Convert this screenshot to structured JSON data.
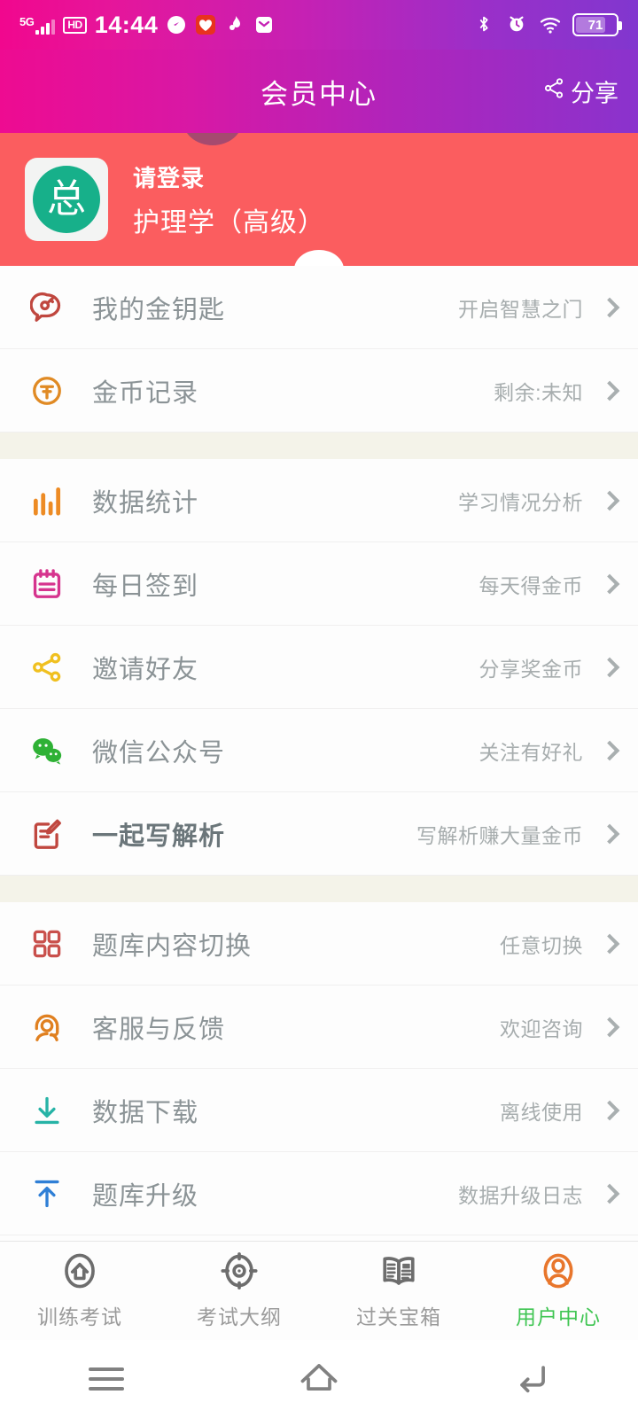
{
  "status_bar": {
    "network": "5G",
    "hd": "HD",
    "time": "14:44",
    "battery_level": "71",
    "left_icons": [
      "signal-icon",
      "hd-icon",
      "compass-icon",
      "heart-badge-icon",
      "flame-icon",
      "mail-icon"
    ],
    "right_icons": [
      "bluetooth-icon",
      "alarm-icon",
      "wifi-icon",
      "battery-icon"
    ]
  },
  "header": {
    "title": "会员中心",
    "share_label": "分享",
    "share_icon": "share-icon"
  },
  "profile": {
    "avatar_text": "总",
    "login_label": "请登录",
    "subject": "护理学（高级）"
  },
  "menu_groups": [
    {
      "items": [
        {
          "icon": "key-bubble-icon",
          "label": "我的金钥匙",
          "hint": "开启智慧之门",
          "color": "#c0473f",
          "strong": false
        },
        {
          "icon": "coin-icon",
          "label": "金币记录",
          "hint": "剩余:未知",
          "color": "#e08a24",
          "strong": false
        }
      ]
    },
    {
      "items": [
        {
          "icon": "bar-chart-icon",
          "label": "数据统计",
          "hint": "学习情况分析",
          "color": "#ed8b24",
          "strong": false
        },
        {
          "icon": "calendar-icon",
          "label": "每日签到",
          "hint": "每天得金币",
          "color": "#d6348e",
          "strong": false
        },
        {
          "icon": "share-nodes-icon",
          "label": "邀请好友",
          "hint": "分享奖金币",
          "color": "#f0c020",
          "strong": false
        },
        {
          "icon": "wechat-icon",
          "label": "微信公众号",
          "hint": "关注有好礼",
          "color": "#2eb135",
          "strong": false
        },
        {
          "icon": "edit-note-icon",
          "label": "一起写解析",
          "hint": "写解析赚大量金币",
          "color": "#c0473f",
          "strong": true
        }
      ]
    },
    {
      "items": [
        {
          "icon": "grid-icon",
          "label": "题库内容切换",
          "hint": "任意切换",
          "color": "#c9504c",
          "strong": false
        },
        {
          "icon": "headset-support-icon",
          "label": "客服与反馈",
          "hint": "欢迎咨询",
          "color": "#e08020",
          "strong": false
        },
        {
          "icon": "download-icon",
          "label": "数据下载",
          "hint": "离线使用",
          "color": "#26b3a6",
          "strong": false
        },
        {
          "icon": "upload-icon",
          "label": "题库升级",
          "hint": "数据升级日志",
          "color": "#2f7fd6",
          "strong": false
        }
      ]
    }
  ],
  "tabbar": {
    "active_index": 3,
    "active_color": "#3fc552",
    "items": [
      {
        "icon": "home-shield-icon",
        "label": "训练考试"
      },
      {
        "icon": "target-icon",
        "label": "考试大纲"
      },
      {
        "icon": "book-news-icon",
        "label": "过关宝箱"
      },
      {
        "icon": "user-oval-icon",
        "label": "用户中心"
      }
    ]
  },
  "android_nav": {
    "buttons": [
      {
        "icon": "recents-icon",
        "name": "recents"
      },
      {
        "icon": "home-icon",
        "name": "home"
      },
      {
        "icon": "back-icon",
        "name": "back"
      }
    ]
  }
}
